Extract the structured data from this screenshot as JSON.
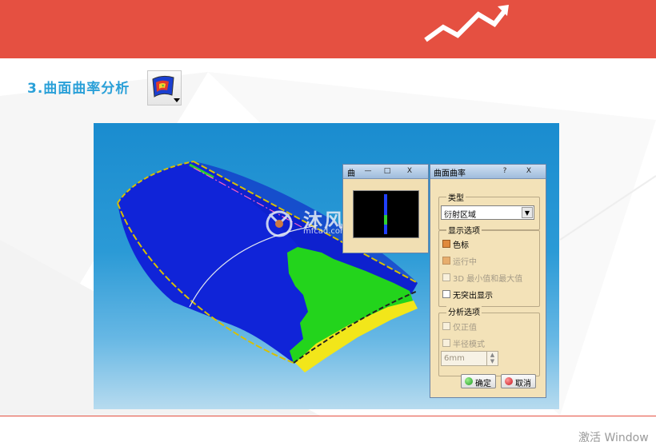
{
  "section": {
    "title": "3.曲面曲率分析"
  },
  "colors": {
    "header": "#e55041",
    "title": "#2aa0d8"
  },
  "watermark": {
    "text": "沐风网",
    "url": "mfcad.com"
  },
  "preview_window": {
    "title": "曲",
    "min_label": "—",
    "restore_label": "□",
    "close_label": "X"
  },
  "dialog": {
    "title": "曲面曲率",
    "help_label": "?",
    "close_label": "X",
    "type_group": "类型",
    "type_value": "衍射区域",
    "display_group": "显示选项",
    "display_options": [
      {
        "label": "色标",
        "checked": true,
        "enabled": true
      },
      {
        "label": "运行中",
        "checked": true,
        "enabled": false
      },
      {
        "label": "3D 最小值和最大值",
        "checked": false,
        "enabled": false
      },
      {
        "label": "无突出显示",
        "checked": false,
        "enabled": true
      }
    ],
    "analysis_group": "分析选项",
    "analysis_options": [
      {
        "label": "仅正值",
        "checked": false,
        "enabled": false
      },
      {
        "label": "半径模式",
        "checked": false,
        "enabled": false
      }
    ],
    "radius_value": "6mm",
    "ok_label": "确定",
    "cancel_label": "取消"
  },
  "footer": {
    "watermark": "激活 Window"
  }
}
